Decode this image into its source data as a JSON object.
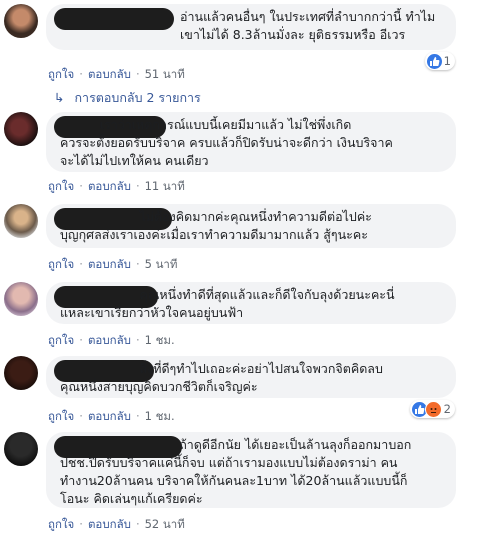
{
  "comments": [
    {
      "text": "อ่านแล้วคนอื่นๆ ในประเทศที่ลำบากกว่านี้ ทำไม\nเขาไม่ได้ 8.3ล้านมั่งละ ยุติธรรมหรือ อีเวร",
      "like": "ถูกใจ",
      "reply": "ตอบกลับ",
      "time": "51 นาที",
      "reaction_count": "1"
    },
    {
      "text": "          เราว่าเหตุการณ์แบบนี้เคยมีมาแล้ว ไม่ใช่พึ่งเกิด\nควรจะตั้งยอดรับบริจาค ครบแล้วก็ปิดรับน่าจะดีกว่า เงินบริจาค\nจะได้ไม่ไปเทให้คน คนเดียว",
      "like": "ถูกใจ",
      "reply": "ตอบกลับ",
      "time": "11 นาที"
    },
    {
      "text": "                    ไม่ต้องคิดมากค่ะคุณหนึ่งทำความดีต่อไปค่ะ\nบุญกุศลส่งเราเองค่ะเมื่อเราทำความดีมามากแล้ว สู้ๆนะคะ",
      "like": "ถูกใจ",
      "reply": "ตอบกลับ",
      "time": "5 นาที"
    },
    {
      "text": "                    คุณหนึ่งทำดีที่สุดแล้วและก็ดีใจกับลุงด้วยนะคะนี่\nแหละเขาเรียกว่าหัวใจคนอยู่บนฟ้า",
      "like": "ถูกใจ",
      "reply": "ตอบกลับ",
      "time": "1 ชม."
    },
    {
      "text": "                    สิ่งที่ดีๆทำไปเถอะค่ะอย่าไปสนใจพวกจิตคิดลบ\nคุณหนึ่งสายบุญคิดบวกชีวิตก็เจริญค่ะ",
      "like": "ถูกใจ",
      "reply": "ตอบกลับ",
      "time": "1 ชม.",
      "reaction_count": "2"
    },
    {
      "text": "                              ถ้าดูดีอีกนัย ได้เยอะเป็นล้านลุงก็ออกมาบอก\nปชช.ปิดรับบริจาคแค่นี้ก็จบ แต่ถ้าเรามองแบบไม่ต้องดราม่า คน\nทำงาน20ล้านคน บริจาคให้กันคนละ1บาท ได้20ล้านแล้วแบบนี้ก็\nโอนะ คิดเล่นๆแก้เครียดค่ะ",
      "like": "ถูกใจ",
      "reply": "ตอบกลับ",
      "time": "52 นาที"
    }
  ],
  "replies_link": "การตอบกลับ 2 รายการ",
  "colors": {
    "link": "#385898",
    "bubble": "#f2f3f5",
    "like": "#3578e5",
    "angry": "#f36b2b"
  }
}
